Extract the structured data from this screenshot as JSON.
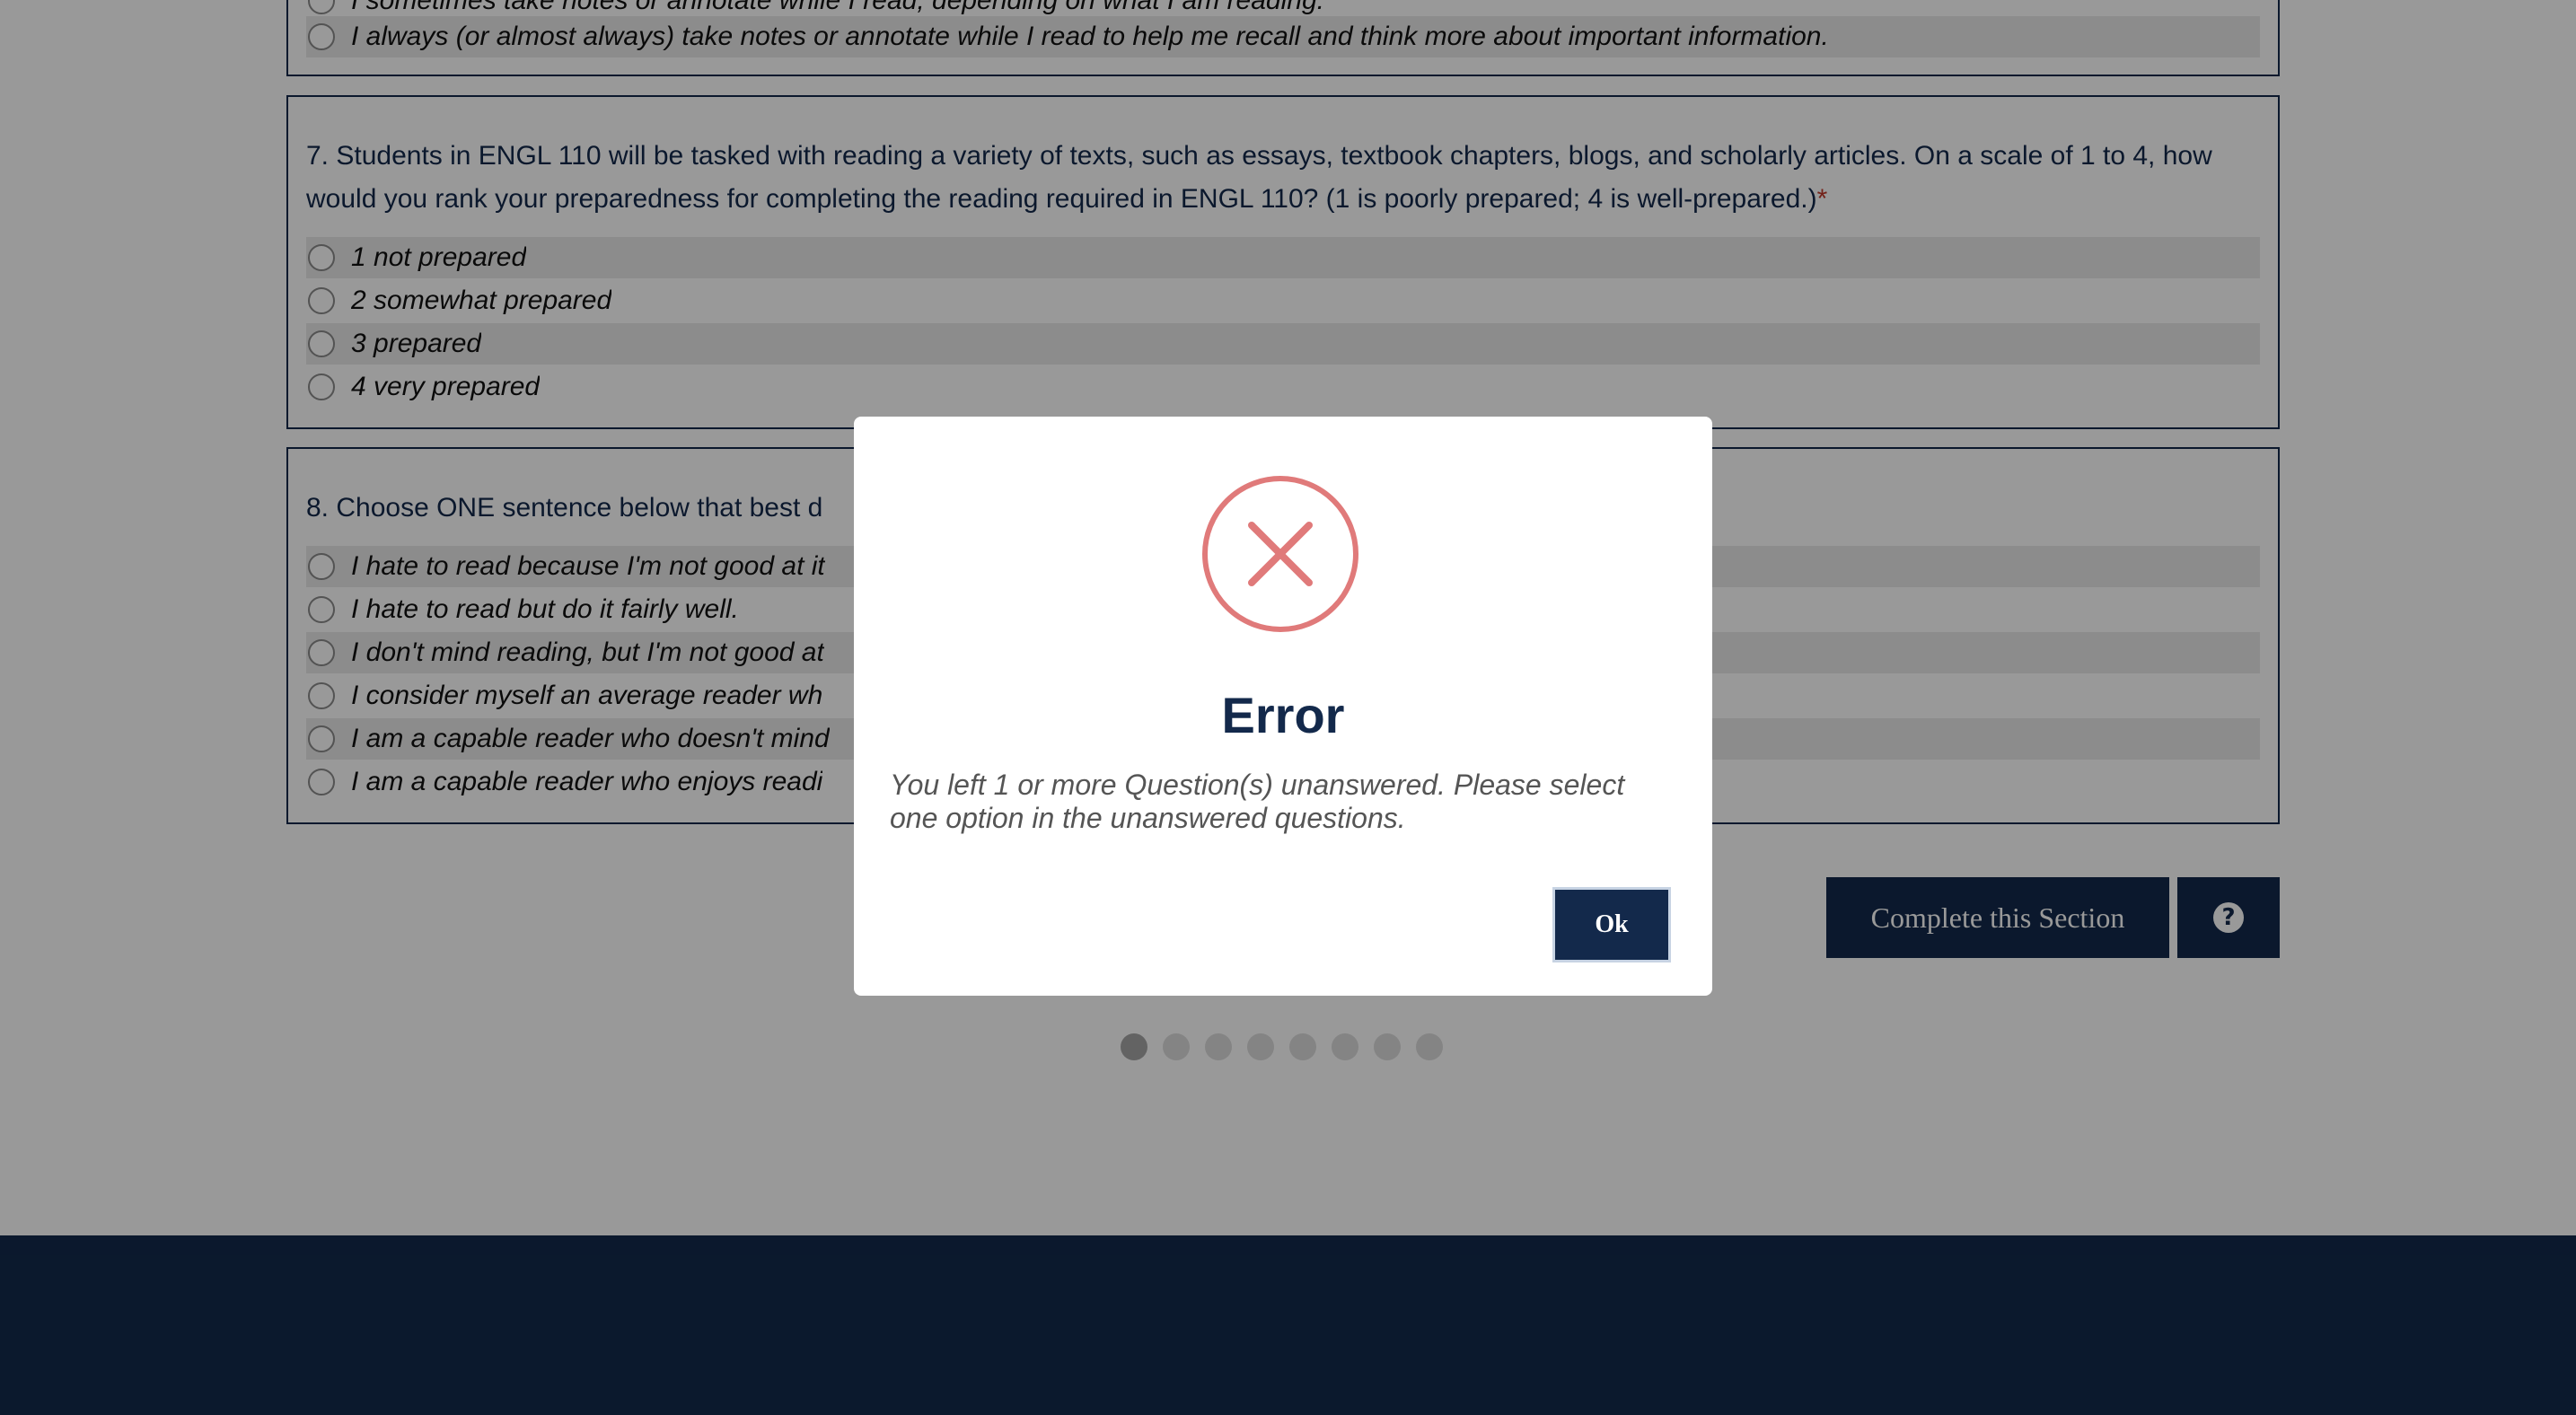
{
  "question6": {
    "options": [
      "I sometimes take notes or annotate while I read, depending on what I am reading.",
      "I always (or almost always) take notes or annotate while I read to help me recall and think more about important information."
    ]
  },
  "question7": {
    "text": "7. Students in ENGL 110 will be tasked with reading a variety of texts, such as essays, textbook chapters, blogs, and scholarly articles. On a scale of 1 to 4, how would you rank your preparedness for completing the reading required in ENGL 110? (1 is poorly prepared; 4 is well-prepared.)",
    "required_marker": "*",
    "options": [
      "1 not prepared",
      "2 somewhat prepared",
      "3 prepared",
      "4 very prepared"
    ]
  },
  "question8": {
    "text": "8. Choose ONE sentence below that best d",
    "options": [
      "I hate to read because I'm not good at it",
      "I hate to read but do it fairly well.",
      "I don't mind reading, but I'm not good at",
      "I consider myself an average reader wh",
      "I am a capable reader who doesn't mind",
      "I am a capable reader who enjoys readi"
    ]
  },
  "actions": {
    "complete_label": "Complete this Section",
    "help_glyph": "?"
  },
  "pagination": {
    "total": 8,
    "current": 1
  },
  "modal": {
    "icon": "error-x-circle-icon",
    "title": "Error",
    "message": "You left 1 or more Question(s) unanswered. Please select one option in the unanswered questions.",
    "ok_label": "Ok"
  },
  "colors": {
    "navy": "#13294b",
    "error_red": "#e07a7a",
    "required_red": "#c0392b"
  }
}
